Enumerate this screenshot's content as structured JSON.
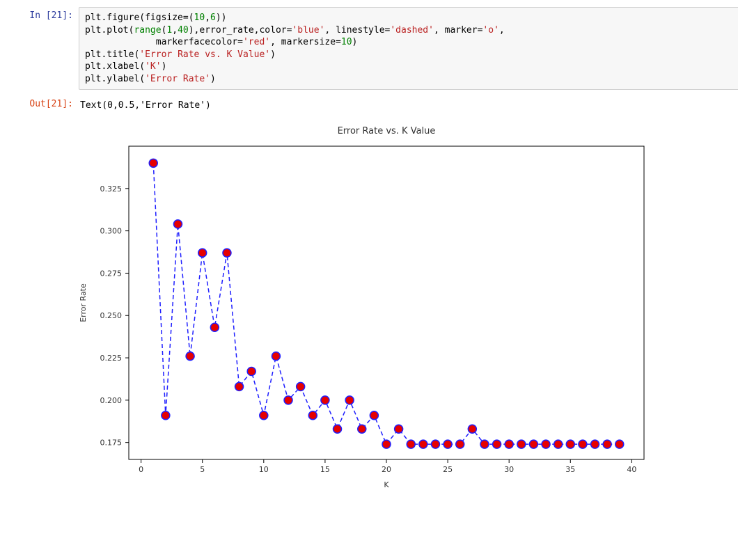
{
  "in_prompt": "In [21]:",
  "out_prompt": "Out[21]:",
  "code": {
    "l1a": "plt.figure(figsize=(",
    "l1_n1": "10",
    "l1_c": ",",
    "l1_n2": "6",
    "l1b": "))",
    "l2a": "plt.plot(",
    "l2_range": "range",
    "l2_po": "(",
    "l2_n1": "1",
    "l2_cc": ",",
    "l2_n2": "40",
    "l2_pc": "),error_rate,color=",
    "l2_s1": "'blue'",
    "l2_c2": ", linestyle=",
    "l2_s2": "'dashed'",
    "l2_c3": ", marker=",
    "l2_s3": "'o'",
    "l2_end": ",",
    "l3_pad": "             markerfacecolor=",
    "l3_s1": "'red'",
    "l3_mid": ", markersize=",
    "l3_n": "10",
    "l3_end": ")",
    "l4a": "plt.title(",
    "l4_s": "'Error Rate vs. K Value'",
    "l4b": ")",
    "l5a": "plt.xlabel(",
    "l5_s": "'K'",
    "l5b": ")",
    "l6a": "plt.ylabel(",
    "l6_s": "'Error Rate'",
    "l6b": ")"
  },
  "output_text": "Text(0,0.5,'Error Rate')",
  "chart_data": {
    "type": "line",
    "title": "Error Rate vs. K Value",
    "xlabel": "K",
    "ylabel": "Error Rate",
    "x": [
      1,
      2,
      3,
      4,
      5,
      6,
      7,
      8,
      9,
      10,
      11,
      12,
      13,
      14,
      15,
      16,
      17,
      18,
      19,
      20,
      21,
      22,
      23,
      24,
      25,
      26,
      27,
      28,
      29,
      30,
      31,
      32,
      33,
      34,
      35,
      36,
      37,
      38,
      39
    ],
    "y": [
      0.34,
      0.191,
      0.304,
      0.226,
      0.287,
      0.243,
      0.287,
      0.208,
      0.217,
      0.191,
      0.226,
      0.2,
      0.208,
      0.191,
      0.2,
      0.183,
      0.2,
      0.183,
      0.191,
      0.174,
      0.183,
      0.174,
      0.174,
      0.174,
      0.174,
      0.174,
      0.183,
      0.174,
      0.174,
      0.174,
      0.174,
      0.174,
      0.174,
      0.174,
      0.174,
      0.174,
      0.174,
      0.174,
      0.174
    ],
    "xticks": [
      0,
      5,
      10,
      15,
      20,
      25,
      30,
      35,
      40
    ],
    "yticks": [
      0.175,
      0.2,
      0.225,
      0.25,
      0.275,
      0.3,
      0.325
    ],
    "xlim": [
      -1,
      41
    ],
    "ylim": [
      0.165,
      0.35
    ],
    "line_color": "#1f1fff",
    "linestyle": "dashed",
    "marker": "o",
    "markerfacecolor": "#e60000",
    "markersize": 10
  }
}
